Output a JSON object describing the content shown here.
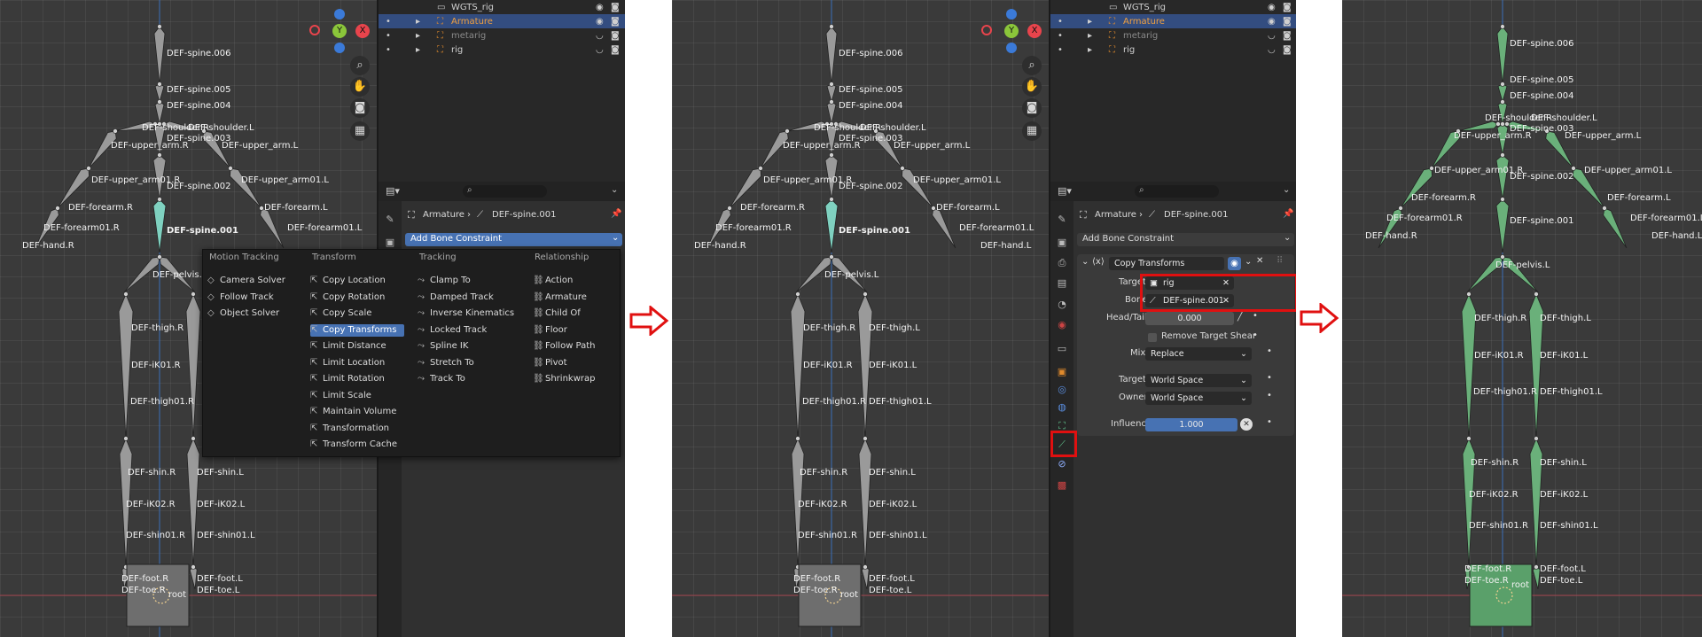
{
  "panel1": {
    "outliner_rows": [
      {
        "name": "WGTS_rig",
        "selected": false
      },
      {
        "name": "Armature",
        "selected": true
      },
      {
        "name": "metarig",
        "selected": false
      },
      {
        "name": "rig",
        "selected": false
      }
    ],
    "breadcrumb": {
      "object": "Armature",
      "bone": "DEF-spine.001"
    },
    "add_constraint_label": "Add Bone Constraint",
    "menu": {
      "headers": [
        "Motion Tracking",
        "Transform",
        "Tracking",
        "Relationship"
      ],
      "motion_tracking": [
        "Camera Solver",
        "Follow Track",
        "Object Solver"
      ],
      "transform": [
        "Copy Location",
        "Copy Rotation",
        "Copy Scale",
        "Copy Transforms",
        "Limit Distance",
        "Limit Location",
        "Limit Rotation",
        "Limit Scale",
        "Maintain Volume",
        "Transformation",
        "Transform Cache"
      ],
      "tracking": [
        "Clamp To",
        "Damped Track",
        "Inverse Kinematics",
        "Locked Track",
        "Spline IK",
        "Stretch To",
        "Track To"
      ],
      "relationship": [
        "Action",
        "Armature",
        "Child Of",
        "Floor",
        "Follow Path",
        "Pivot",
        "Shrinkwrap"
      ],
      "active_item": "Copy Transforms"
    }
  },
  "panel2": {
    "outliner_rows": [
      {
        "name": "WGTS_rig",
        "selected": false
      },
      {
        "name": "Armature",
        "selected": true
      },
      {
        "name": "metarig",
        "selected": false
      },
      {
        "name": "rig",
        "selected": false
      }
    ],
    "breadcrumb": {
      "object": "Armature",
      "bone": "DEF-spine.001"
    },
    "add_constraint_label": "Add Bone Constraint",
    "constraint": {
      "name": "Copy Transforms",
      "target_label": "Target",
      "target_value": "rig",
      "bone_label": "Bone",
      "bone_value": "DEF-spine.001",
      "head_tail_label": "Head/Tail",
      "head_tail_value": "0.000",
      "remove_shear_label": "Remove Target Shear",
      "mix_label": "Mix",
      "mix_value": "Replace",
      "target_space_label": "Target",
      "target_space_value": "World Space",
      "owner_label": "Owner",
      "owner_space_value": "World Space",
      "influence_label": "Influence",
      "influence_value": "1.000"
    }
  },
  "panel1_bones": [
    "DEF-spine.006",
    "DEF-spine.005",
    "DEF-spine.004",
    "DEF-shoulder.R",
    "DEF-shoulder.L",
    "DEF-spine.003",
    "DEF-upper_arm.R",
    "DEF-upper_arm.L",
    "DEF-upper_arm01.R",
    "DEF-upper_arm01.L",
    "DEF-spine.002",
    "DEF-forearm.R",
    "DEF-forearm.L",
    "DEF-forearm01.R",
    "DEF-forearm01.L",
    "DEF-spine.001",
    "DEF-hand.R",
    "DEF-pelvis.R",
    "DEF-thigh.R",
    "DEF-iK01.R",
    "DEF-thigh01.R",
    "DEF-shin.R",
    "DEF-shin.L",
    "DEF-iK02.R",
    "DEF-iK02.L",
    "DEF-shin01.R",
    "DEF-shin01.L",
    "DEF-foot.R",
    "DEF-foot.L",
    "DEF-toe.R",
    "DEF-toe.L",
    "root"
  ],
  "panel2_bones": [
    "DEF-spine.006",
    "DEF-spine.005",
    "DEF-spine.004",
    "DEF-shoulder.R",
    "DEF-shoulder.L",
    "DEF-spine.003",
    "DEF-upper_arm.R",
    "DEF-upper_arm.L",
    "DEF-upper_arm01.R",
    "DEF-upper_arm01.L",
    "DEF-spine.002",
    "DEF-forearm.R",
    "DEF-forearm.L",
    "DEF-forearm01.R",
    "DEF-forearm01.L",
    "DEF-spine.001",
    "DEF-hand.R",
    "DEF-hand.L",
    "DEF-pelvis.L",
    "DEF-thigh.R",
    "DEF-thigh.L",
    "DEF-iK01.R",
    "DEF-iK01.L",
    "DEF-thigh01.R",
    "DEF-thigh01.L",
    "DEF-shin.R",
    "DEF-shin.L",
    "DEF-iK02.R",
    "DEF-iK02.L",
    "DEF-shin01.R",
    "DEF-shin01.L",
    "DEF-foot.R",
    "DEF-foot.L",
    "DEF-toe.R",
    "DEF-toe.L",
    "root"
  ],
  "panel3_bones": [
    "DEF-spine.006",
    "DEF-spine.005",
    "DEF-spine.004",
    "DEF-shoulder.R",
    "DEF-shoulder.L",
    "DEF-spine.003",
    "DEF-upper_arm.R",
    "DEF-upper_arm.L",
    "DEF-upper_arm01.R",
    "DEF-upper_arm01.L",
    "DEF-spine.002",
    "DEF-forearm.R",
    "DEF-forearm.L",
    "DEF-forearm01.R",
    "DEF-forearm01.L",
    "DEF-spine.001",
    "DEF-hand.R",
    "DEF-hand.L",
    "DEF-pelvis.L",
    "DEF-thigh.R",
    "DEF-thigh.L",
    "DEF-iK01.R",
    "DEF-iK01.L",
    "DEF-thigh01.R",
    "DEF-thigh01.L",
    "DEF-shin.R",
    "DEF-shin.L",
    "DEF-iK02.R",
    "DEF-iK02.L",
    "DEF-shin01.R",
    "DEF-shin01.L",
    "DEF-foot.R",
    "DEF-foot.L",
    "DEF-toe.R",
    "DEF-toe.L",
    "root"
  ],
  "colors": {
    "viewport_bg": "#3a3a3a",
    "bone_gray": "#9a9a9a",
    "bone_selected": "#7fd1c0",
    "bone_constrained": "#6ab07a",
    "highlight_red": "#e01010",
    "accent_blue": "#4772b3",
    "gizmo_x": "#e8444c",
    "gizmo_y": "#8bc63a",
    "gizmo_z": "#3b7ad8"
  }
}
